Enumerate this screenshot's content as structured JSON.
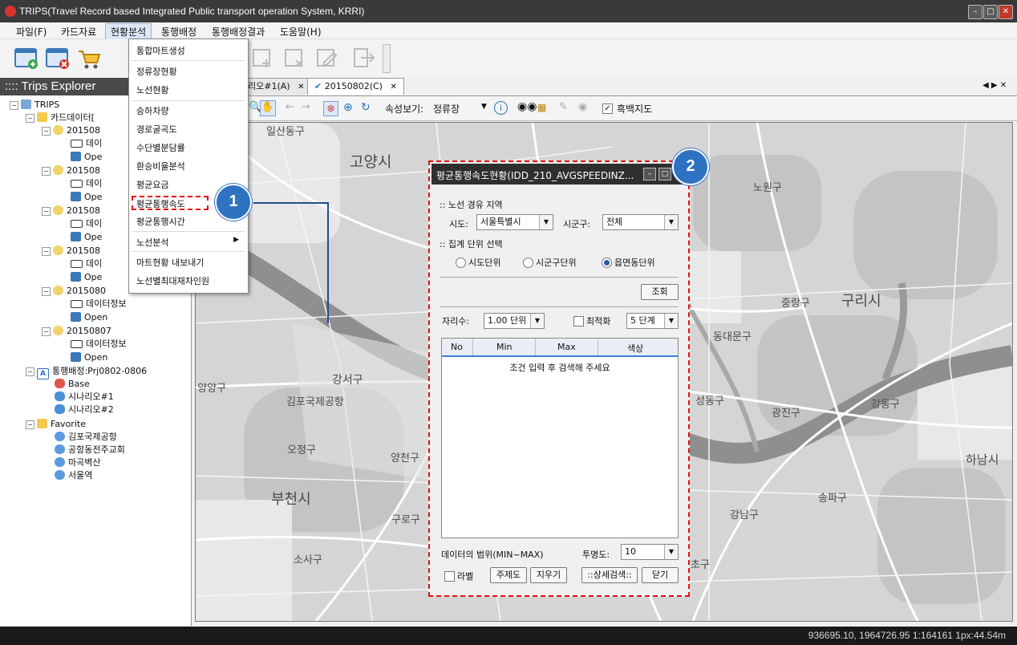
{
  "window": {
    "title": "TRIPS(Travel Record based Integrated Public transport operation System, KRRI)"
  },
  "menubar": {
    "items": [
      "파일(F)",
      "카드자료",
      "현황분석",
      "통행배정",
      "통행배정결과",
      "도움말(H)"
    ]
  },
  "dropdown": {
    "items": [
      "통합마트생성",
      "정류장현황",
      "노선현황",
      "승하차량",
      "경로굴곡도",
      "수단별분담률",
      "환승비율분석",
      "평균요금",
      "평균통행속도",
      "평균통행시간",
      "노선분석",
      "마트현황 내보내기",
      "노선별최대재차인원"
    ],
    "highlighted": "평균통행속도"
  },
  "explorer": {
    "title": ":::: Trips Explorer",
    "root": "TRIPS",
    "card_data_label": "카드데이터[",
    "dates_partial": [
      "201508",
      "201508",
      "201508",
      "201508",
      "201508"
    ],
    "date_full": "20150807",
    "date_last_partial": "2015080",
    "data_info_short": "데이",
    "data_info": "데이터정보",
    "open_short": "Ope",
    "open": "Open",
    "assign_project": "통행배정:Prj0802-0806",
    "base": "Base",
    "scenarios": [
      "시나리오#1",
      "시나리오#2"
    ],
    "favorite": "Favorite",
    "favorites": [
      "김포국제공항",
      "공항동전주교회",
      "마곡벽산",
      "서울역"
    ]
  },
  "tabs": [
    {
      "label": "리오#1(A)"
    },
    {
      "label": "20150802(C)"
    }
  ],
  "map_toolbar": {
    "attr_view_label": "속성보기:",
    "attr_view_value": "정류장",
    "bw_map_label": "흑백지도"
  },
  "map": {
    "places": [
      "일산동구",
      "고양시",
      "노원구",
      "중랑구",
      "구리시",
      "동대문구",
      "강서구",
      "김포국제공항",
      "성동구",
      "광진구",
      "강동구",
      "오정구",
      "양천구",
      "하남시",
      "부천시",
      "구로구",
      "송파구",
      "강남구",
      "소사구",
      "양양구",
      "초구"
    ]
  },
  "dialog": {
    "title": "평균통행속도현황(IDD_210_AVGSPEEDINZ...",
    "section_route_region": ":: 노선 경유 지역",
    "sido_label": "시도:",
    "sido_value": "서울특별시",
    "sigungu_label": "시군구:",
    "sigungu_value": "전체",
    "section_unit": ":: 집계 단위 선택",
    "radio_options": [
      "시도단위",
      "시군구단위",
      "읍면동단위"
    ],
    "radio_selected": "읍면동단위",
    "query_button": "조회",
    "digits_label": "자리수:",
    "digits_value": "1.00 단위",
    "optimize_label": "최적화",
    "steps_value": "5 단계",
    "table_headers": [
      "No",
      "Min",
      "Max",
      "색상"
    ],
    "table_empty_message": "조건 입력 후 검색해 주세요",
    "data_range_label": "데이터의 범위(MIN~MAX)",
    "opacity_label": "투명도:",
    "opacity_value": "10",
    "label_checkbox": "라벨",
    "buttons": [
      "주제도",
      "지우기",
      "::상세검색::",
      "닫기"
    ]
  },
  "callouts": [
    "1",
    "2"
  ],
  "status": {
    "text": "936695.10, 1964726.95   1:164161   1px:44.54m"
  },
  "colors": {
    "accent_blue": "#2e72c2",
    "highlight_red": "#e01010",
    "title_bar": "#3a3a3a"
  }
}
